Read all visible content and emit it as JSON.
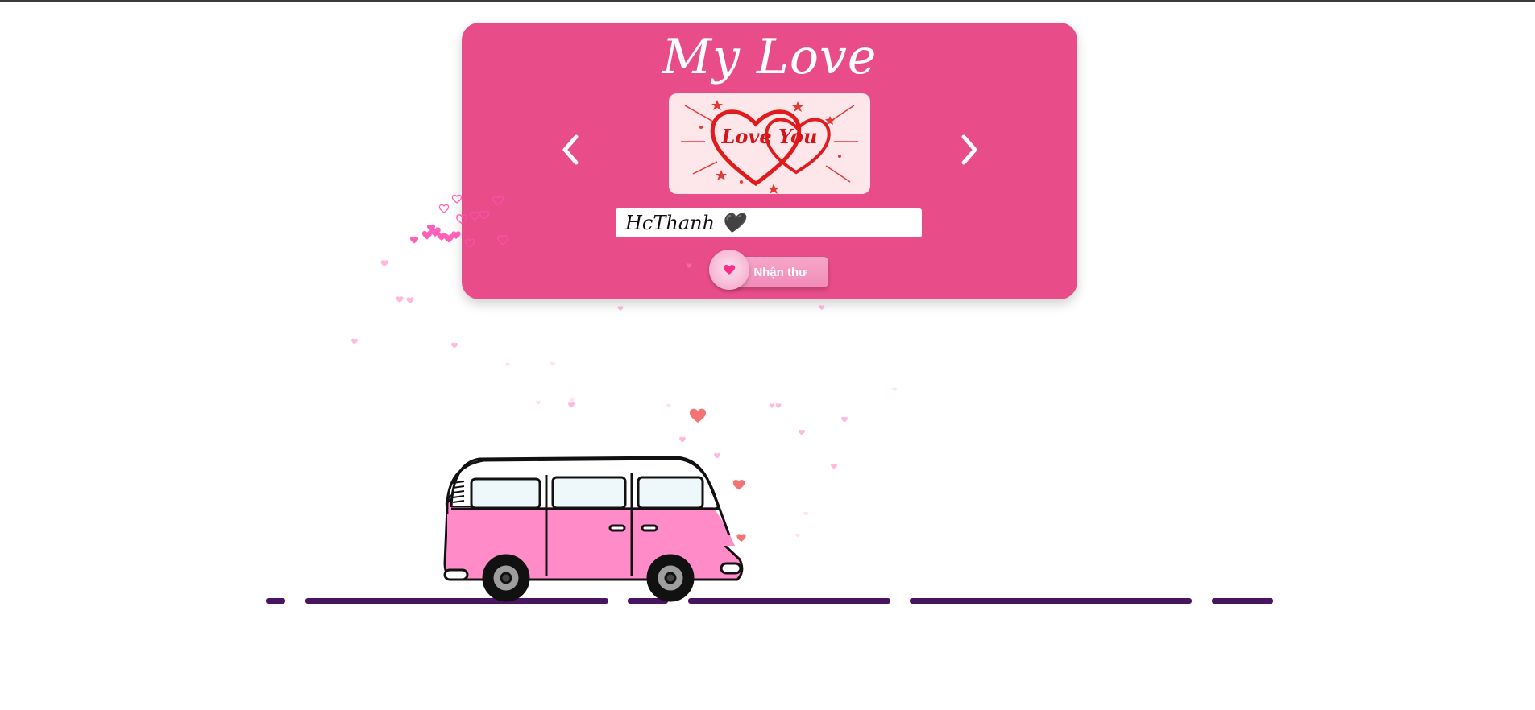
{
  "page": {
    "title": "My Love",
    "image_text": "Love You",
    "message_input": {
      "value": "HcThanh 🖤",
      "placeholder": ""
    },
    "receive_button": {
      "label": "Nhận thư"
    }
  },
  "colors": {
    "card": "#e84d8a",
    "button": "#f08cb8",
    "road": "#4a1560",
    "van_body": "#ff8cc8",
    "hearts": "#ff69b4"
  },
  "icons": [
    "chevron-left-icon",
    "chevron-right-icon",
    "heart-icon",
    "van-illustration"
  ]
}
